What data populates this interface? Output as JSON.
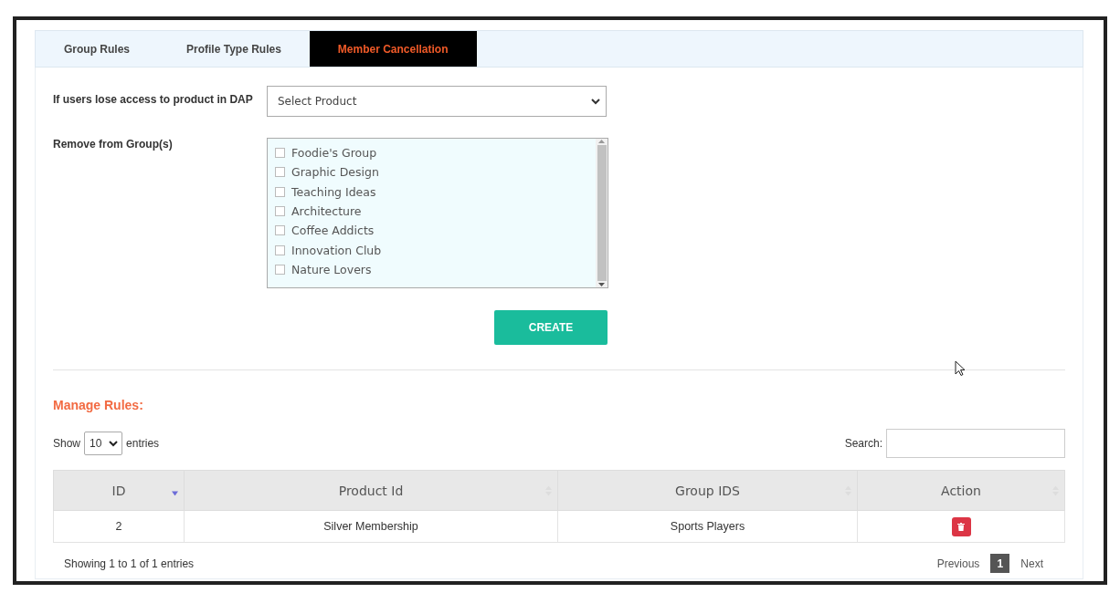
{
  "tabs": [
    {
      "label": "Group Rules",
      "selected": false
    },
    {
      "label": "Profile Type Rules",
      "selected": false
    },
    {
      "label": "Member Cancellation",
      "selected": true
    }
  ],
  "form": {
    "product_label": "If users lose access to product in DAP",
    "product_select": "Select Product",
    "groups_label": "Remove from Group(s)",
    "groups": [
      {
        "label": "Foodie's Group",
        "checked": false
      },
      {
        "label": "Graphic Design",
        "checked": false
      },
      {
        "label": "Teaching Ideas",
        "checked": false
      },
      {
        "label": "Architecture",
        "checked": false
      },
      {
        "label": "Coffee Addicts",
        "checked": false
      },
      {
        "label": "Innovation Club",
        "checked": false
      },
      {
        "label": "Nature Lovers",
        "checked": false
      }
    ],
    "create_button": "CREATE"
  },
  "manage": {
    "title": "Manage Rules:",
    "show_label": "Show",
    "page_size": "10",
    "entries_label": "entries",
    "search_label": "Search:",
    "columns": [
      {
        "label": "ID",
        "sorted": true
      },
      {
        "label": "Product Id",
        "sorted": false
      },
      {
        "label": "Group IDS",
        "sorted": false
      },
      {
        "label": "Action",
        "sorted": false
      }
    ],
    "rows": [
      {
        "id": "2",
        "product": "Silver Membership",
        "groups": "Sports Players"
      }
    ],
    "info": "Showing 1 to 1 of 1 entries",
    "pagination": {
      "previous": "Previous",
      "pages": [
        {
          "label": "1",
          "selected": true
        }
      ],
      "next": "Next"
    }
  }
}
